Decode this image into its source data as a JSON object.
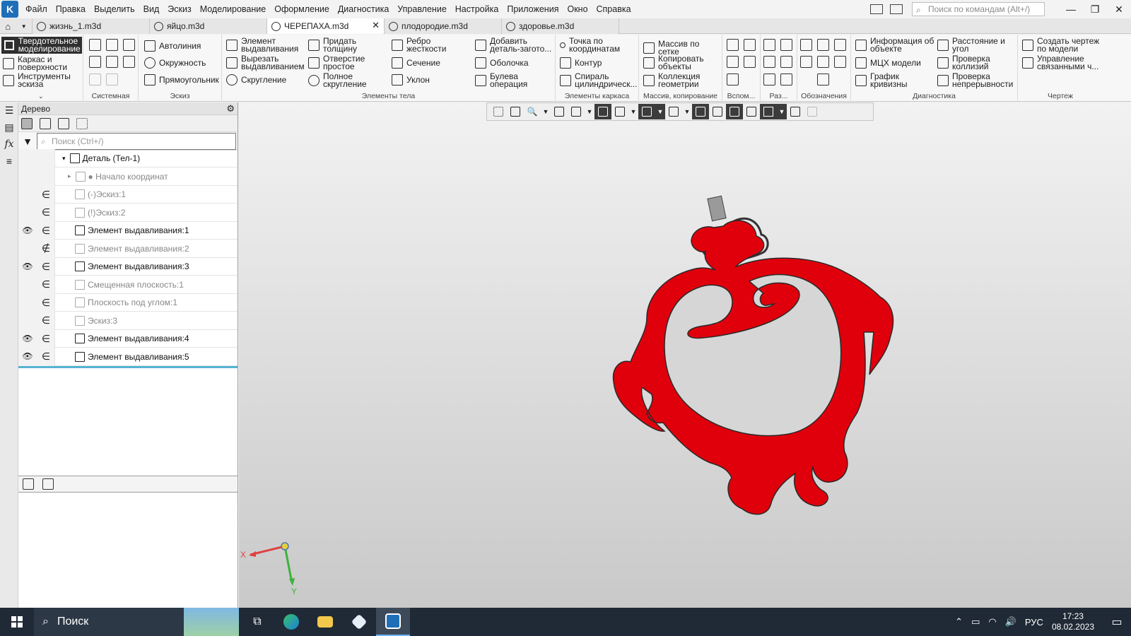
{
  "menubar": {
    "items": [
      "Файл",
      "Правка",
      "Выделить",
      "Вид",
      "Эскиз",
      "Моделирование",
      "Оформление",
      "Диагностика",
      "Управление",
      "Настройка",
      "Приложения",
      "Окно",
      "Справка"
    ],
    "search_placeholder": "Поиск по командам (Alt+/)"
  },
  "tabs": [
    {
      "label": "жизнь_1.m3d",
      "active": false
    },
    {
      "label": "яйцо.m3d",
      "active": false
    },
    {
      "label": "ЧЕРЕПАХА.m3d",
      "active": true
    },
    {
      "label": "плодородие.m3d",
      "active": false
    },
    {
      "label": "здоровье.m3d",
      "active": false
    }
  ],
  "ribbon": {
    "modes": [
      "Твердотельное моделирование",
      "Каркас и поверхности",
      "Инструменты эскиза"
    ],
    "groups": {
      "system": "Системная",
      "sketch": "Эскиз",
      "body": "Элементы тела",
      "frame": "Элементы каркаса",
      "array": "Массив, копирование",
      "aux": "Вспом...",
      "size": "Раз...",
      "marks": "Обозначения",
      "diag": "Диагностика",
      "drawing": "Чертеж"
    },
    "sketch_buttons": [
      "Автолиния",
      "Окружность",
      "Прямоугольник"
    ],
    "body_buttons": [
      "Элемент\nвыдавливания",
      "Вырезать\nвыдавливанием",
      "Скругление",
      "Придать\nтолщину",
      "Отверстие\nпростое",
      "Полное\nскругление",
      "Ребро\nжесткости",
      "Сечение",
      "Уклон",
      "Добавить\nдеталь-загото...",
      "Оболочка",
      "Булева\nоперация"
    ],
    "frame_buttons": [
      "Точка по\nкоординатам",
      "Контур",
      "Спираль\nцилиндрическ..."
    ],
    "array_buttons": [
      "Массив по сетке",
      "Копировать\nобъекты",
      "Коллекция\nгеометрии"
    ],
    "diag_buttons": [
      "Информация об\nобъекте",
      "МЦХ модели",
      "График\nкривизны",
      "Расстояние и\nугол",
      "Проверка\nколлизий",
      "Проверка\nнепрерывности"
    ],
    "drawing_buttons": [
      "Создать чертеж\nпо модели",
      "Управление\nсвязанными ч..."
    ]
  },
  "tree": {
    "title": "Дерево",
    "search_placeholder": "Поиск (Ctrl+/)",
    "rows": [
      {
        "label": "Деталь (Тел-1)",
        "eye": "",
        "in": "",
        "style": "strong",
        "prefix": "▾"
      },
      {
        "label": "● Начало координат",
        "eye": "",
        "in": "",
        "style": "dim",
        "prefix": "▸"
      },
      {
        "label": "(-)Эскиз:1",
        "eye": "",
        "in": "∈",
        "style": "dim",
        "prefix": ""
      },
      {
        "label": "(!)Эскиз:2",
        "eye": "",
        "in": "∈",
        "style": "dim",
        "prefix": ""
      },
      {
        "label": "Элемент выдавливания:1",
        "eye": "👁",
        "in": "∈",
        "style": "strong",
        "prefix": ""
      },
      {
        "label": "Элемент выдавливания:2",
        "eye": "",
        "in": "∉",
        "style": "dim",
        "prefix": ""
      },
      {
        "label": "Элемент выдавливания:3",
        "eye": "👁",
        "in": "∈",
        "style": "strong",
        "prefix": ""
      },
      {
        "label": "Смещенная плоскость:1",
        "eye": "",
        "in": "∈",
        "style": "dim",
        "prefix": ""
      },
      {
        "label": "Плоскость под углом:1",
        "eye": "",
        "in": "∈",
        "style": "dim",
        "prefix": ""
      },
      {
        "label": "Эскиз:3",
        "eye": "",
        "in": "∈",
        "style": "dim",
        "prefix": ""
      },
      {
        "label": "Элемент выдавливания:4",
        "eye": "👁",
        "in": "∈",
        "style": "strong",
        "prefix": ""
      },
      {
        "label": "Элемент выдавливания:5",
        "eye": "👁",
        "in": "∈",
        "style": "strong",
        "prefix": ""
      }
    ]
  },
  "viewport": {
    "axis_x": "X",
    "axis_y": "Y",
    "model_color": "#e0000b"
  },
  "taskbar": {
    "search_label": "Поиск",
    "language": "РУС",
    "time": "17:23",
    "date": "08.02.2023"
  }
}
